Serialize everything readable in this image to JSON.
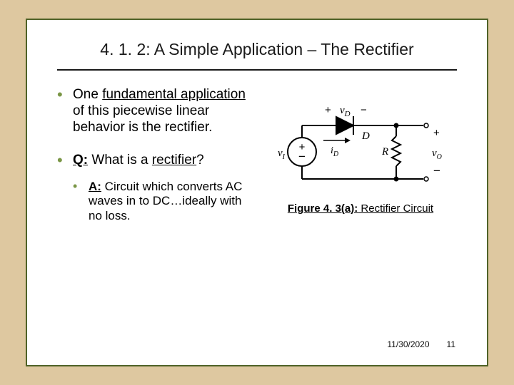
{
  "title": "4. 1. 2: A Simple Application – The Rectifier",
  "bullets": {
    "b1_pre": "One ",
    "b1_u": "fundamental application",
    "b1_post": " of this piecewise linear behavior is the rectifier.",
    "b2_q": "Q:",
    "b2_mid": " What is a ",
    "b2_rect": "rectifier",
    "b2_end": "?",
    "sub_a": "A:",
    "sub_body": " Circuit which converts AC waves in to DC…ideally with no loss."
  },
  "figure": {
    "caption_b": "Figure 4. 3(a):",
    "caption_rest": " Rectifier Circuit",
    "labels": {
      "vD_plus": "+",
      "vD_minus": "−",
      "vD": "v",
      "vD_sub": "D",
      "iD": "i",
      "iD_sub": "D",
      "D": "D",
      "R": "R",
      "vI": "v",
      "vI_sub": "I",
      "vO": "v",
      "vO_sub": "O",
      "plus": "+",
      "minus": "−"
    }
  },
  "footer": {
    "date": "11/30/2020",
    "page": "11"
  }
}
